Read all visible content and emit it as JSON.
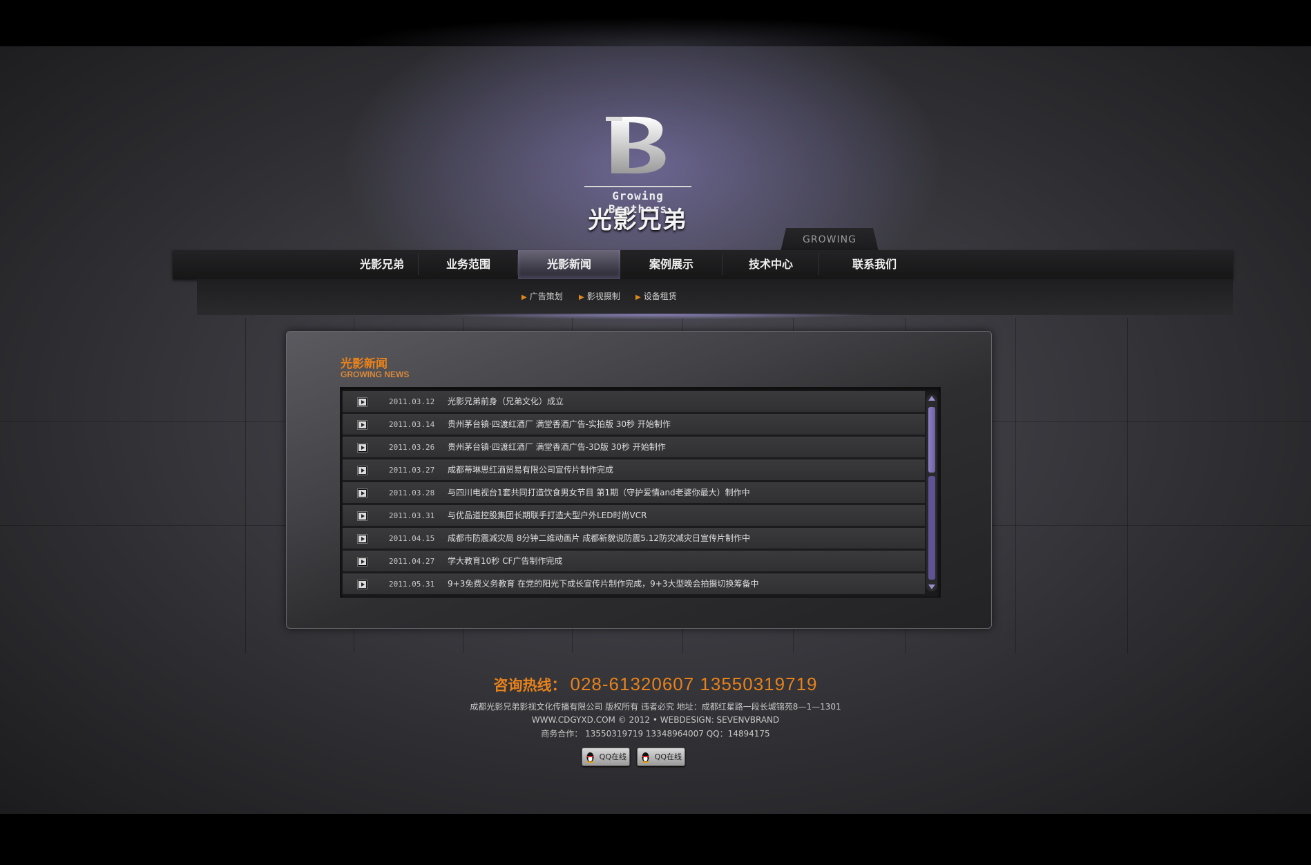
{
  "logo": {
    "english": "Growing Brothers",
    "chinese": "光影兄弟"
  },
  "growing_tab": "GROWING",
  "nav": {
    "items": [
      {
        "label": "光影兄弟"
      },
      {
        "label": "业务范围"
      },
      {
        "label": "光影新闻",
        "active": true
      },
      {
        "label": "案例展示"
      },
      {
        "label": "技术中心"
      },
      {
        "label": "联系我们"
      }
    ]
  },
  "subnav": {
    "items": [
      "广告策划",
      "影视摄制",
      "设备租赁"
    ]
  },
  "news": {
    "title": "光影新闻",
    "subtitle": "GROWING NEWS",
    "rows": [
      {
        "date": "2011.03.12",
        "title": "光影兄弟前身（兄弟文化）成立"
      },
      {
        "date": "2011.03.14",
        "title": "贵州茅台镇·四渡红酒厂  满堂香酒广告-实拍版 30秒 开始制作"
      },
      {
        "date": "2011.03.26",
        "title": "贵州茅台镇·四渡红酒厂  满堂香酒广告-3D版 30秒 开始制作"
      },
      {
        "date": "2011.03.27",
        "title": "成都蒂琳思红酒贸易有限公司宣传片制作完成"
      },
      {
        "date": "2011.03.28",
        "title": "与四川电视台1套共同打造饮食男女节目 第1期（守护爱情and老婆你最大）制作中"
      },
      {
        "date": "2011.03.31",
        "title": "与优品道控股集团长期联手打造大型户外LED时尚VCR"
      },
      {
        "date": "2011.04.15",
        "title": "成都市防震减灾局 8分钟二维动画片 成都新貌说防震5.12防灾减灾日宣传片制作中"
      },
      {
        "date": "2011.04.27",
        "title": "学大教育10秒 CF广告制作完成"
      },
      {
        "date": "2011.05.31",
        "title": "9+3免费义务教育 在党的阳光下成长宣传片制作完成，9+3大型晚会拍摄切换筹备中"
      }
    ]
  },
  "footer": {
    "hotline_label": "咨询热线：",
    "hotline_number": "028-61320607  13550319719",
    "line1": "成都光影兄弟影视文化传播有限公司  版权所有  违者必究  地址：成都红星路一段长城锦苑8—1—1301",
    "line2": "WWW.CDGYXD.COM © 2012 • WEBDESIGN: SEVENVBRAND",
    "line3": "商务合作： 13550319719  13348964007  QQ：14894175",
    "qq_buttons": [
      "QQ在线",
      "QQ在线"
    ]
  },
  "colors": {
    "accent": "#e8821b",
    "scroll": "#7b6db3"
  }
}
